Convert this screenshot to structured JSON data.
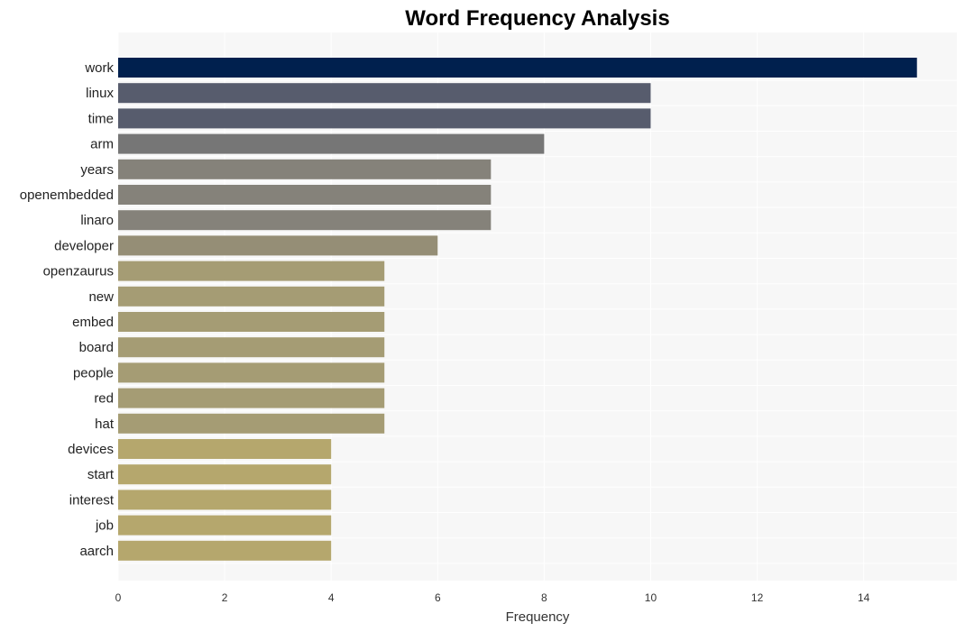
{
  "chart_data": {
    "type": "bar",
    "orientation": "horizontal",
    "title": "Word Frequency Analysis",
    "xlabel": "Frequency",
    "ylabel": "",
    "xlim": [
      0,
      15.75
    ],
    "xticks": [
      0,
      2,
      4,
      6,
      8,
      10,
      12,
      14
    ],
    "grid": true,
    "categories": [
      "work",
      "linux",
      "time",
      "arm",
      "years",
      "openembedded",
      "linaro",
      "developer",
      "openzaurus",
      "new",
      "embed",
      "board",
      "people",
      "red",
      "hat",
      "devices",
      "start",
      "interest",
      "job",
      "aarch"
    ],
    "values": [
      15,
      10,
      10,
      8,
      7,
      7,
      7,
      6,
      5,
      5,
      5,
      5,
      5,
      5,
      5,
      4,
      4,
      4,
      4,
      4
    ],
    "colors": [
      "#00204e",
      "#575c6d",
      "#575c6d",
      "#767676",
      "#85827a",
      "#85827a",
      "#85827a",
      "#958e76",
      "#a59c74",
      "#a59c74",
      "#a59c74",
      "#a59c74",
      "#a59c74",
      "#a59c74",
      "#a59c74",
      "#b5a76d",
      "#b5a76d",
      "#b5a76d",
      "#b5a76d",
      "#b5a76d"
    ],
    "background": "#f7f7f7"
  }
}
